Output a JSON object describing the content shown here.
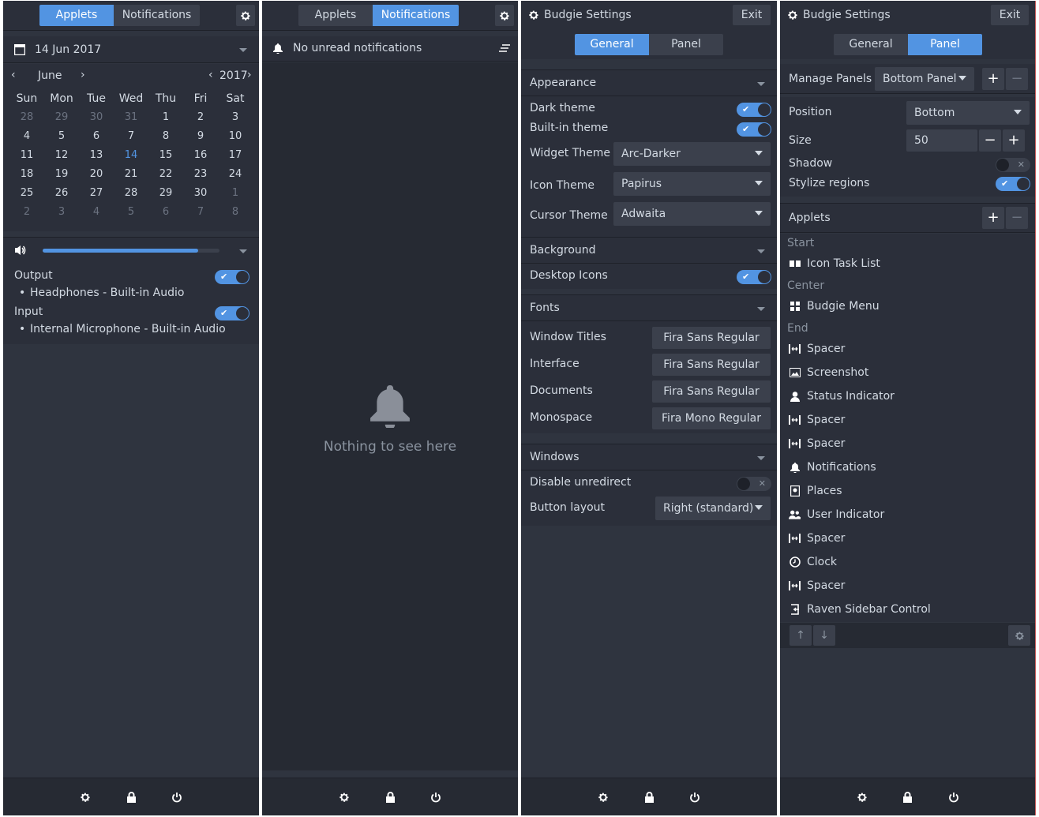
{
  "panel1": {
    "tabs": [
      "Applets",
      "Notifications"
    ],
    "active_tab": 0,
    "date": "14 Jun 2017",
    "month": "June",
    "year": "2017",
    "weekdays": [
      "Sun",
      "Mon",
      "Tue",
      "Wed",
      "Thu",
      "Fri",
      "Sat"
    ],
    "weeks": [
      [
        "28",
        "29",
        "30",
        "31",
        "1",
        "2",
        "3"
      ],
      [
        "4",
        "5",
        "6",
        "7",
        "8",
        "9",
        "10"
      ],
      [
        "11",
        "12",
        "13",
        "14",
        "15",
        "16",
        "17"
      ],
      [
        "18",
        "19",
        "20",
        "21",
        "22",
        "23",
        "24"
      ],
      [
        "25",
        "26",
        "27",
        "28",
        "29",
        "30",
        "1"
      ],
      [
        "2",
        "3",
        "4",
        "5",
        "6",
        "7",
        "8"
      ]
    ],
    "volume_level": 0.88,
    "output_label": "Output",
    "output_device": "Headphones - Built-in Audio",
    "input_label": "Input",
    "input_device": "Internal Microphone - Built-in Audio"
  },
  "panel2": {
    "tabs": [
      "Applets",
      "Notifications"
    ],
    "active_tab": 1,
    "header": "No unread notifications",
    "empty_text": "Nothing to see here"
  },
  "panel3": {
    "title": "Budgie Settings",
    "exit_label": "Exit",
    "tabs": [
      "General",
      "Panel"
    ],
    "appearance": "Appearance",
    "dark_theme": "Dark theme",
    "builtin_theme": "Built-in theme",
    "widget_theme_label": "Widget Theme",
    "widget_theme": "Arc-Darker",
    "icon_theme_label": "Icon Theme",
    "icon_theme": "Papirus",
    "cursor_theme_label": "Cursor Theme",
    "cursor_theme": "Adwaita",
    "background": "Background",
    "desktop_icons": "Desktop Icons",
    "fonts": "Fonts",
    "window_titles_label": "Window Titles",
    "window_titles_font": "Fira Sans Regular",
    "interface_label": "Interface",
    "interface_font": "Fira Sans Regular",
    "documents_label": "Documents",
    "documents_font": "Fira Sans Regular",
    "monospace_label": "Monospace",
    "monospace_font": "Fira Mono Regular",
    "windows": "Windows",
    "disable_unredirect": "Disable unredirect",
    "button_layout_label": "Button layout",
    "button_layout": "Right (standard)"
  },
  "panel4": {
    "title": "Budgie Settings",
    "exit_label": "Exit",
    "tabs": [
      "General",
      "Panel"
    ],
    "manage_panels": "Manage Panels",
    "panel_select": "Bottom Panel",
    "position_label": "Position",
    "position": "Bottom",
    "size_label": "Size",
    "size": "50",
    "shadow_label": "Shadow",
    "stylize_label": "Stylize regions",
    "applets_label": "Applets",
    "start": "Start",
    "center": "Center",
    "end": "End",
    "start_items": [
      "Icon Task List"
    ],
    "center_items": [
      "Budgie Menu"
    ],
    "end_items": [
      "Spacer",
      "Screenshot",
      "Status Indicator",
      "Spacer",
      "Spacer",
      "Notifications",
      "Places",
      "User Indicator",
      "Spacer",
      "Clock",
      "Spacer",
      "Raven Sidebar Control"
    ]
  },
  "colors": {
    "accent": "#5294e2",
    "bg": "#2f343f",
    "bar": "#2b2f3a"
  }
}
